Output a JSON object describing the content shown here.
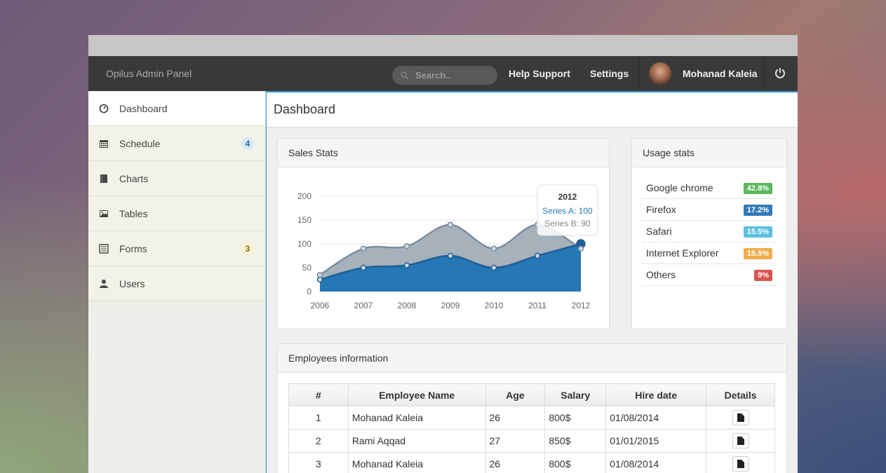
{
  "app": {
    "brand": "Opilus Admin Panel"
  },
  "topnav": {
    "search_placeholder": "Search..",
    "help": "Help Support",
    "settings": "Settings",
    "user_name": "Mohanad Kaleia"
  },
  "sidebar": {
    "items": [
      {
        "label": "Dashboard",
        "icon": "dashboard-icon"
      },
      {
        "label": "Schedule",
        "icon": "calendar-icon",
        "badge": "4"
      },
      {
        "label": "Charts",
        "icon": "book-icon"
      },
      {
        "label": "Tables",
        "icon": "image-icon"
      },
      {
        "label": "Forms",
        "icon": "list-icon",
        "badge": "3"
      },
      {
        "label": "Users",
        "icon": "user-icon"
      }
    ]
  },
  "page": {
    "title": "Dashboard"
  },
  "sales": {
    "title": "Sales Stats",
    "tooltip": {
      "year": "2012",
      "a": "Series A: 100",
      "b": "Series B: 90"
    }
  },
  "chart_data": {
    "type": "area",
    "title": "Sales Stats",
    "x": [
      "2006",
      "2007",
      "2008",
      "2009",
      "2010",
      "2011",
      "2012"
    ],
    "series": [
      {
        "name": "Series A",
        "values": [
          25,
          50,
          55,
          75,
          50,
          75,
          100
        ],
        "color": "#2577b5"
      },
      {
        "name": "Series B",
        "values": [
          35,
          90,
          95,
          140,
          90,
          140,
          90
        ],
        "color": "#a6b1ba"
      }
    ],
    "ylim": [
      0,
      200
    ],
    "yticks": [
      "0",
      "50",
      "100",
      "150",
      "200"
    ],
    "stacked": false,
    "grid": true
  },
  "usage": {
    "title": "Usage stats",
    "items": [
      {
        "name": "Google chrome",
        "value": "42.8%",
        "color": "#5cb85c"
      },
      {
        "name": "Firefox",
        "value": "17.2%",
        "color": "#337ab7"
      },
      {
        "name": "Safari",
        "value": "15.5%",
        "color": "#5bc0de"
      },
      {
        "name": "Internet Explorer",
        "value": "15.5%",
        "color": "#f0ad4e"
      },
      {
        "name": "Others",
        "value": "9%",
        "color": "#d9534f"
      }
    ]
  },
  "employees": {
    "title": "Employees information",
    "columns": [
      "#",
      "Employee Name",
      "Age",
      "Salary",
      "Hire date",
      "Details"
    ],
    "rows": [
      {
        "num": "1",
        "name": "Mohanad Kaleia",
        "age": "26",
        "salary": "800$",
        "hire": "01/08/2014"
      },
      {
        "num": "2",
        "name": "Rami Aqqad",
        "age": "27",
        "salary": "850$",
        "hire": "01/01/2015"
      },
      {
        "num": "3",
        "name": "Mohanad Kaleia",
        "age": "26",
        "salary": "800$",
        "hire": "01/08/2014"
      }
    ]
  }
}
